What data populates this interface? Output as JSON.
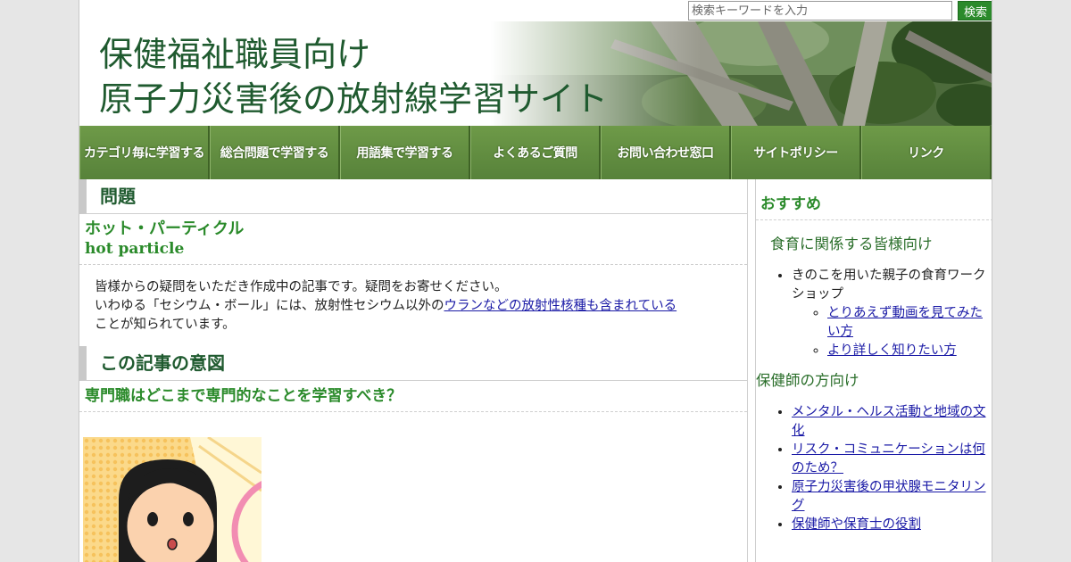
{
  "search": {
    "placeholder": "検索キーワードを入力",
    "button_label": "検索"
  },
  "header": {
    "title_line1": "保健福祉職員向け",
    "title_line2": "原子力災害後の放射線学習サイト"
  },
  "nav": {
    "items": [
      {
        "label": "カテゴリ毎に学習する"
      },
      {
        "label": "総合問題で学習する"
      },
      {
        "label": "用語集で学習する"
      },
      {
        "label": "よくあるご質問"
      },
      {
        "label": "お問い合わせ窓口"
      },
      {
        "label": "サイトポリシー"
      },
      {
        "label": "リンク"
      }
    ]
  },
  "main": {
    "question_heading": "問題",
    "article_title_jp": "ホット・パーティクル",
    "article_title_en": "hot particle",
    "body_line1": "皆様からの疑問をいただき作成中の記事です。疑問をお寄せください。",
    "body_line2_prefix": "いわゆる「セシウム・ボール」には、放射性セシウム以外の",
    "body_link": "ウランなどの放射性核種も含まれている",
    "body_line2_suffix": "ことが知られています。",
    "intent_heading": "この記事の意図",
    "intent_question": "専門職はどこまで専門的なことを学習すべき？"
  },
  "sidebar": {
    "heading": "おすすめ",
    "group1": {
      "title": "食育に関係する皆様向け",
      "item": "きのこを用いた親子の食育ワークショップ",
      "subitems": [
        "とりあえず動画を見てみたい方",
        "より詳しく知りたい方"
      ]
    },
    "group2": {
      "title": "保健師の方向け",
      "items": [
        "メンタル・ヘルス活動と地域の文化",
        "リスク・コミュニケーションは何のため？",
        "原子力災害後の甲状腺モニタリング",
        "保健師や保育士の役割"
      ]
    }
  },
  "colors": {
    "brand_green": "#1f5a2f",
    "nav_green": "#5f8a3c",
    "accent_green": "#2a8a2a",
    "link_blue": "#1a1aa6"
  }
}
